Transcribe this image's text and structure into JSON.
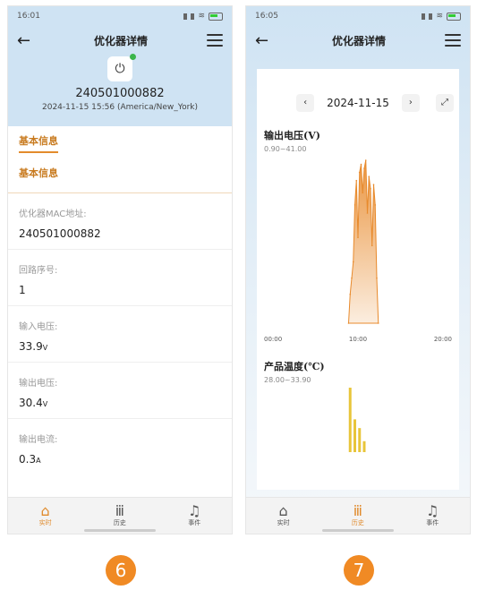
{
  "screens": [
    {
      "status_time": "16:01",
      "title": "优化器详情",
      "serial": "240501000882",
      "timestamp": "2024-11-15 15:56 (America/New_York)",
      "tab_active": "基本信息",
      "section_title": "基本信息",
      "fields": [
        {
          "label": "优化器MAC地址:",
          "value": "240501000882",
          "unit": ""
        },
        {
          "label": "回路序号:",
          "value": "1",
          "unit": ""
        },
        {
          "label": "输入电压:",
          "value": "33.9",
          "unit": "V"
        },
        {
          "label": "输出电压:",
          "value": "30.4",
          "unit": "V"
        },
        {
          "label": "输出电流:",
          "value": "0.3",
          "unit": "A"
        }
      ]
    },
    {
      "status_time": "16:05",
      "title": "优化器详情",
      "date": "2024-11-15",
      "charts": [
        {
          "title": "输出电压(V)",
          "range": "0.90~41.00"
        },
        {
          "title": "产品温度(℃)",
          "range": "28.00~33.90"
        }
      ]
    }
  ],
  "nav": {
    "realtime": "实时",
    "history": "历史",
    "events": "事件"
  },
  "badges": [
    "6",
    "7"
  ],
  "chart_data": [
    {
      "type": "area",
      "title": "输出电压(V)",
      "range_label": "0.90~41.00",
      "x_ticks": [
        "00:00",
        "10:00",
        "20:00"
      ],
      "x_hours": [
        10.8,
        11.0,
        11.2,
        11.4,
        11.6,
        11.8,
        12.0,
        12.2,
        12.4,
        12.6,
        12.8,
        13.0,
        13.2,
        13.4,
        13.6,
        13.8,
        14.0,
        14.2,
        14.4,
        14.6
      ],
      "values": [
        0.9,
        8,
        12,
        16,
        30,
        36,
        22,
        38,
        40,
        33,
        39,
        41,
        28,
        37,
        34,
        20,
        35,
        30,
        12,
        0.9
      ],
      "ylim": [
        0.9,
        41.0
      ],
      "color": "#e88a2c"
    },
    {
      "type": "bar",
      "title": "产品温度(℃)",
      "range_label": "28.00~33.90",
      "x_hours": [
        11.0,
        11.6,
        12.2,
        12.8
      ],
      "values": [
        33.9,
        31.0,
        30.2,
        29.0
      ],
      "ylim": [
        28.0,
        33.9
      ],
      "color": "#e8c53a"
    }
  ]
}
